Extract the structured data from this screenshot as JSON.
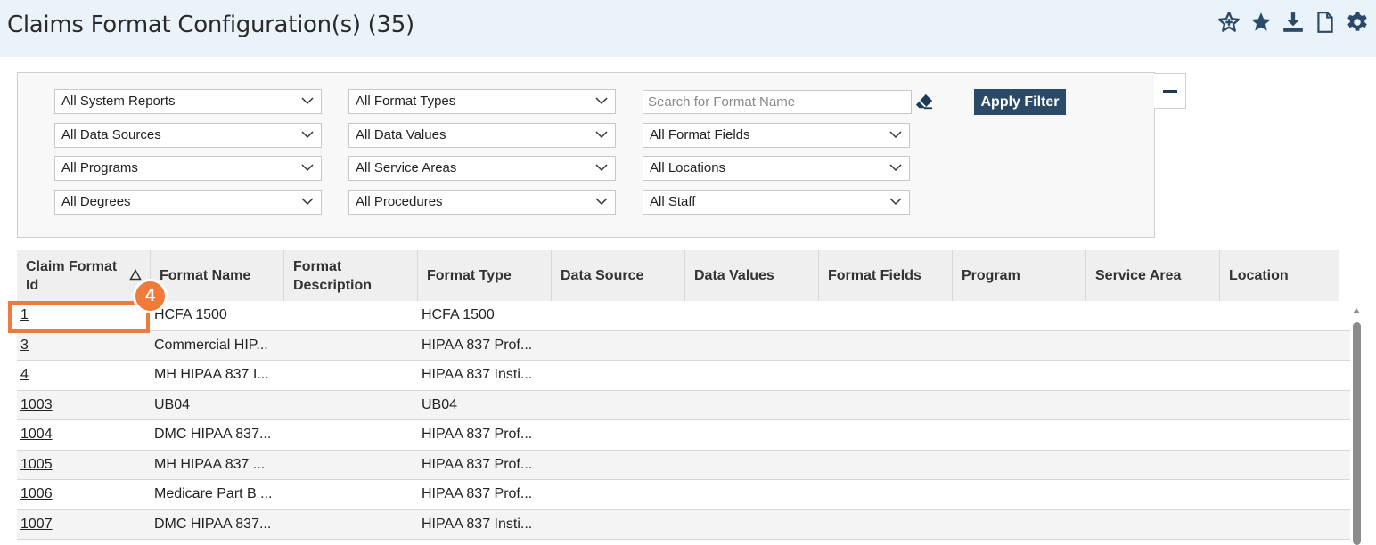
{
  "header": {
    "title": "Claims Format Configuration(s) (35)",
    "icons": [
      "favorite-add-icon",
      "star-icon",
      "download-icon",
      "document-icon",
      "gear-icon"
    ]
  },
  "filters": {
    "col1": [
      "All System Reports",
      "All Data Sources",
      "All Programs",
      "All Degrees"
    ],
    "col2": [
      "All Format Types",
      "All Data Values",
      "All Service Areas",
      "All Procedures"
    ],
    "col3": [
      "All Format Fields",
      "All Locations",
      "All Staff"
    ],
    "search_placeholder": "Search for Format Name",
    "search_value": "",
    "apply_label": "Apply Filter"
  },
  "grid": {
    "columns": [
      "Claim Format Id",
      "Format Name",
      "Format Description",
      "Format Type",
      "Data Source",
      "Data Values",
      "Format Fields",
      "Program",
      "Service Area",
      "Location"
    ],
    "rows": [
      {
        "id": "1",
        "name": "HCFA 1500",
        "type": "HCFA 1500"
      },
      {
        "id": "3",
        "name": "Commercial HIP...",
        "type": "HIPAA 837 Prof..."
      },
      {
        "id": "4",
        "name": "MH HIPAA 837 I...",
        "type": "HIPAA 837 Insti..."
      },
      {
        "id": "1003",
        "name": "UB04",
        "type": "UB04"
      },
      {
        "id": "1004",
        "name": "DMC HIPAA 837...",
        "type": "HIPAA 837 Prof..."
      },
      {
        "id": "1005",
        "name": "MH HIPAA 837 ...",
        "type": "HIPAA 837 Prof..."
      },
      {
        "id": "1006",
        "name": "Medicare Part B ...",
        "type": "HIPAA 837 Prof..."
      },
      {
        "id": "1007",
        "name": "DMC HIPAA 837...",
        "type": "HIPAA 837 Insti..."
      }
    ]
  },
  "annotation": {
    "step_number": "4",
    "accent_color": "#f07a3a"
  }
}
